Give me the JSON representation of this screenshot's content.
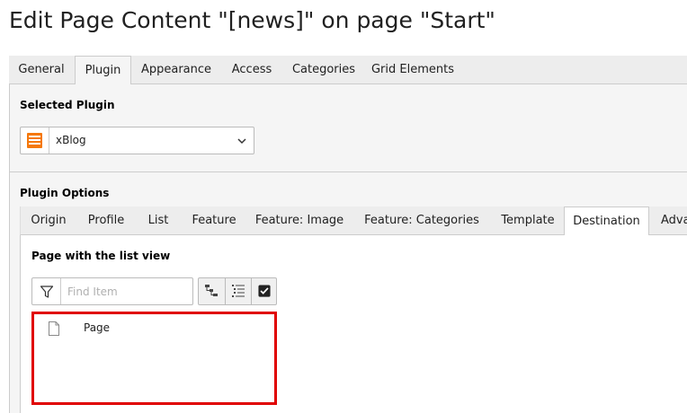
{
  "page": {
    "title": "Edit Page Content \"[news]\" on page \"Start\""
  },
  "main_tabs": [
    {
      "label": "General",
      "active": false
    },
    {
      "label": "Plugin",
      "active": true
    },
    {
      "label": "Appearance",
      "active": false
    },
    {
      "label": "Access",
      "active": false
    },
    {
      "label": "Categories",
      "active": false
    },
    {
      "label": "Grid Elements",
      "active": false
    }
  ],
  "plugin": {
    "section_label": "Selected Plugin",
    "selected_value": "xBlog",
    "icon": "plugin-list-icon",
    "icon_color": "#f5780a"
  },
  "plugin_options": {
    "section_label": "Plugin Options",
    "tabs": [
      {
        "label": "Origin",
        "active": false
      },
      {
        "label": "Profile",
        "active": false
      },
      {
        "label": "List",
        "active": false
      },
      {
        "label": "Feature",
        "active": false
      },
      {
        "label": "Feature: Image",
        "active": false
      },
      {
        "label": "Feature: Categories",
        "active": false
      },
      {
        "label": "Template",
        "active": false
      },
      {
        "label": "Destination",
        "active": true
      },
      {
        "label": "Adva",
        "active": false
      }
    ]
  },
  "destination": {
    "field_label": "Page with the list view",
    "find_placeholder": "Find Item",
    "find_value": "",
    "toolbar_icons": [
      "tree-view-icon",
      "list-view-icon",
      "checkbox-icon"
    ],
    "items": [
      {
        "label": "Page",
        "icon": "page-icon"
      }
    ],
    "highlight_color": "#e00000"
  }
}
